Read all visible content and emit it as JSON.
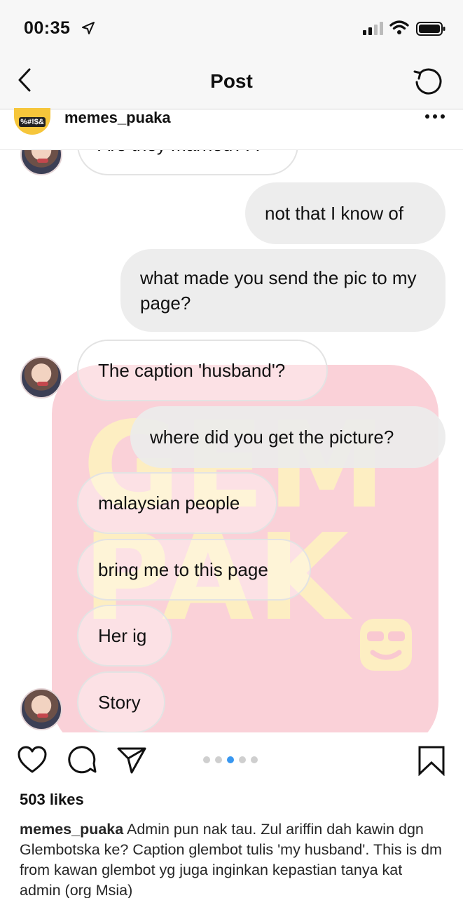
{
  "status_bar": {
    "time": "00:35"
  },
  "nav": {
    "title": "Post"
  },
  "post": {
    "username": "memes_puaka",
    "avatar_text": "%#!$&"
  },
  "messages": [
    {
      "direction": "in",
      "text": "Are they married???"
    },
    {
      "direction": "out",
      "text": "not that I know of"
    },
    {
      "direction": "out",
      "text": "what made you send the pic to my page?"
    },
    {
      "direction": "in",
      "text": "The caption 'husband'?"
    },
    {
      "direction": "out",
      "text": "where did you get the picture?"
    },
    {
      "direction": "in",
      "text": "malaysian people"
    },
    {
      "direction": "in",
      "text": "bring me to this page"
    },
    {
      "direction": "in",
      "text": "Her ig"
    },
    {
      "direction": "in",
      "text": "Story"
    }
  ],
  "watermark": {
    "text_line1": "GEM",
    "text_line2": "PAK"
  },
  "carousel": {
    "count": 5,
    "active_index": 2
  },
  "likes": "503 likes",
  "caption": {
    "username": "memes_puaka",
    "text": "Admin pun nak tau. Zul ariffin dah kawin dgn Glembotska ke? Caption glembot tulis 'my husband'. This is dm from kawan glembot yg juga inginkan kepastian tanya kat admin (org Msia)"
  },
  "colors": {
    "accent": "#3897f0",
    "bubble_out": "#ebebeb",
    "watermark_bg": "#f9c9d1",
    "watermark_text": "#fdeec2"
  },
  "icons": [
    "location-arrow-icon",
    "signal-icon",
    "wifi-icon",
    "battery-icon",
    "back-chevron-icon",
    "refresh-icon",
    "more-icon",
    "heart-icon",
    "comment-icon",
    "share-icon",
    "bookmark-icon"
  ]
}
